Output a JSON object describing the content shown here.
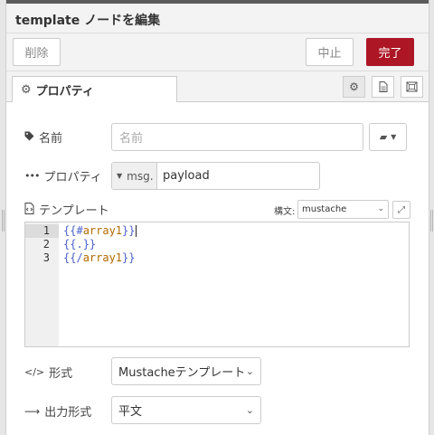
{
  "dialog": {
    "title": "template ノードを編集",
    "delete_label": "削除",
    "cancel_label": "中止",
    "done_label": "完了"
  },
  "tabs": {
    "properties_label": "プロパティ",
    "icons": [
      "gear-icon",
      "document-icon",
      "frame-icon"
    ]
  },
  "form": {
    "name_label": "名前",
    "name_placeholder": "名前",
    "name_value": "",
    "property_label": "プロパティ",
    "property_prefix": "msg.",
    "property_value": "payload",
    "template_label": "テンプレート",
    "syntax_label": "構文:",
    "syntax_value": "mustache",
    "format_label": "形式",
    "format_value": "Mustacheテンプレート",
    "output_label": "出力形式",
    "output_value": "平文"
  },
  "editor": {
    "line_numbers": [
      "1",
      "2",
      "3"
    ],
    "lines": [
      {
        "open": "{{#",
        "key": "array1",
        "close": "}}"
      },
      {
        "open": "{{.",
        "key": "",
        "close": "}}"
      },
      {
        "open": "{{/",
        "key": "array1",
        "close": "}}"
      }
    ]
  },
  "colors": {
    "accent": "#ad1625",
    "mustache_brace": "#4a60cc",
    "mustache_key": "#b26a00"
  }
}
